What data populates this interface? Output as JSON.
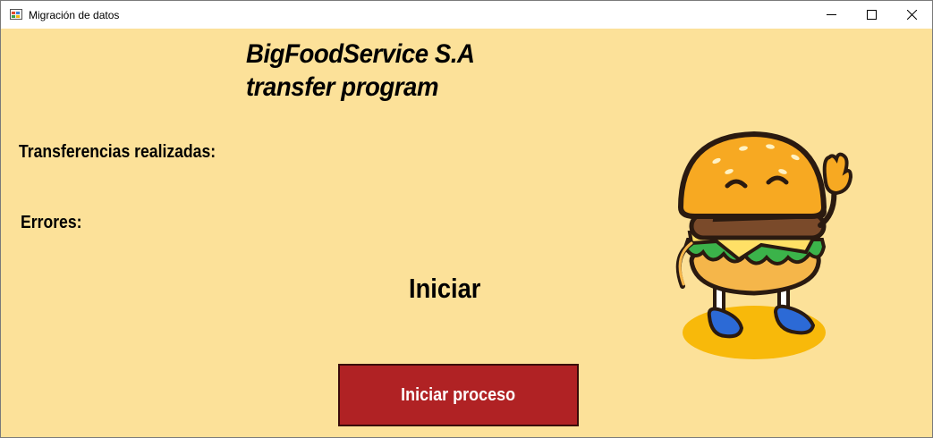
{
  "window": {
    "title": "Migración de datos",
    "icon": "app-window-icon",
    "controls": [
      "minimize-icon",
      "maximize-icon",
      "close-icon"
    ]
  },
  "header": {
    "line1": "BigFoodService S.A",
    "line2": "transfer program"
  },
  "labels": {
    "transfers": "Transferencias realizadas:",
    "errors": "Errores:",
    "status": "Iniciar"
  },
  "actions": {
    "start_label": "Iniciar proceso"
  },
  "colors": {
    "background": "#fce199",
    "button": "#b02224",
    "button_text": "#ffffff"
  },
  "mascot": {
    "icon": "burger-mascot-icon"
  }
}
